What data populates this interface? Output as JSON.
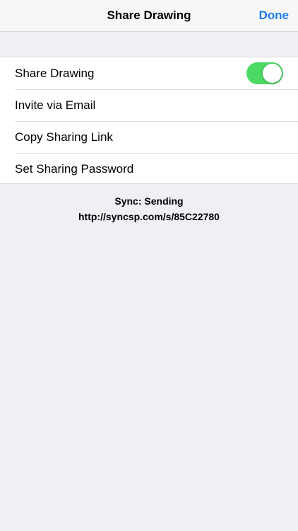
{
  "nav": {
    "title": "Share Drawing",
    "done_label": "Done",
    "done_color": "#1a7ef0"
  },
  "settings": {
    "rows": [
      {
        "label": "Share Drawing",
        "control": "toggle",
        "toggle_on": true,
        "toggle_color": "#4cd964"
      },
      {
        "label": "Invite via Email"
      },
      {
        "label": "Copy Sharing Link"
      },
      {
        "label": "Set Sharing Password"
      }
    ]
  },
  "footer": {
    "sync_status": "Sync: Sending",
    "share_url": "http://syncsp.com/s/85C22780"
  }
}
